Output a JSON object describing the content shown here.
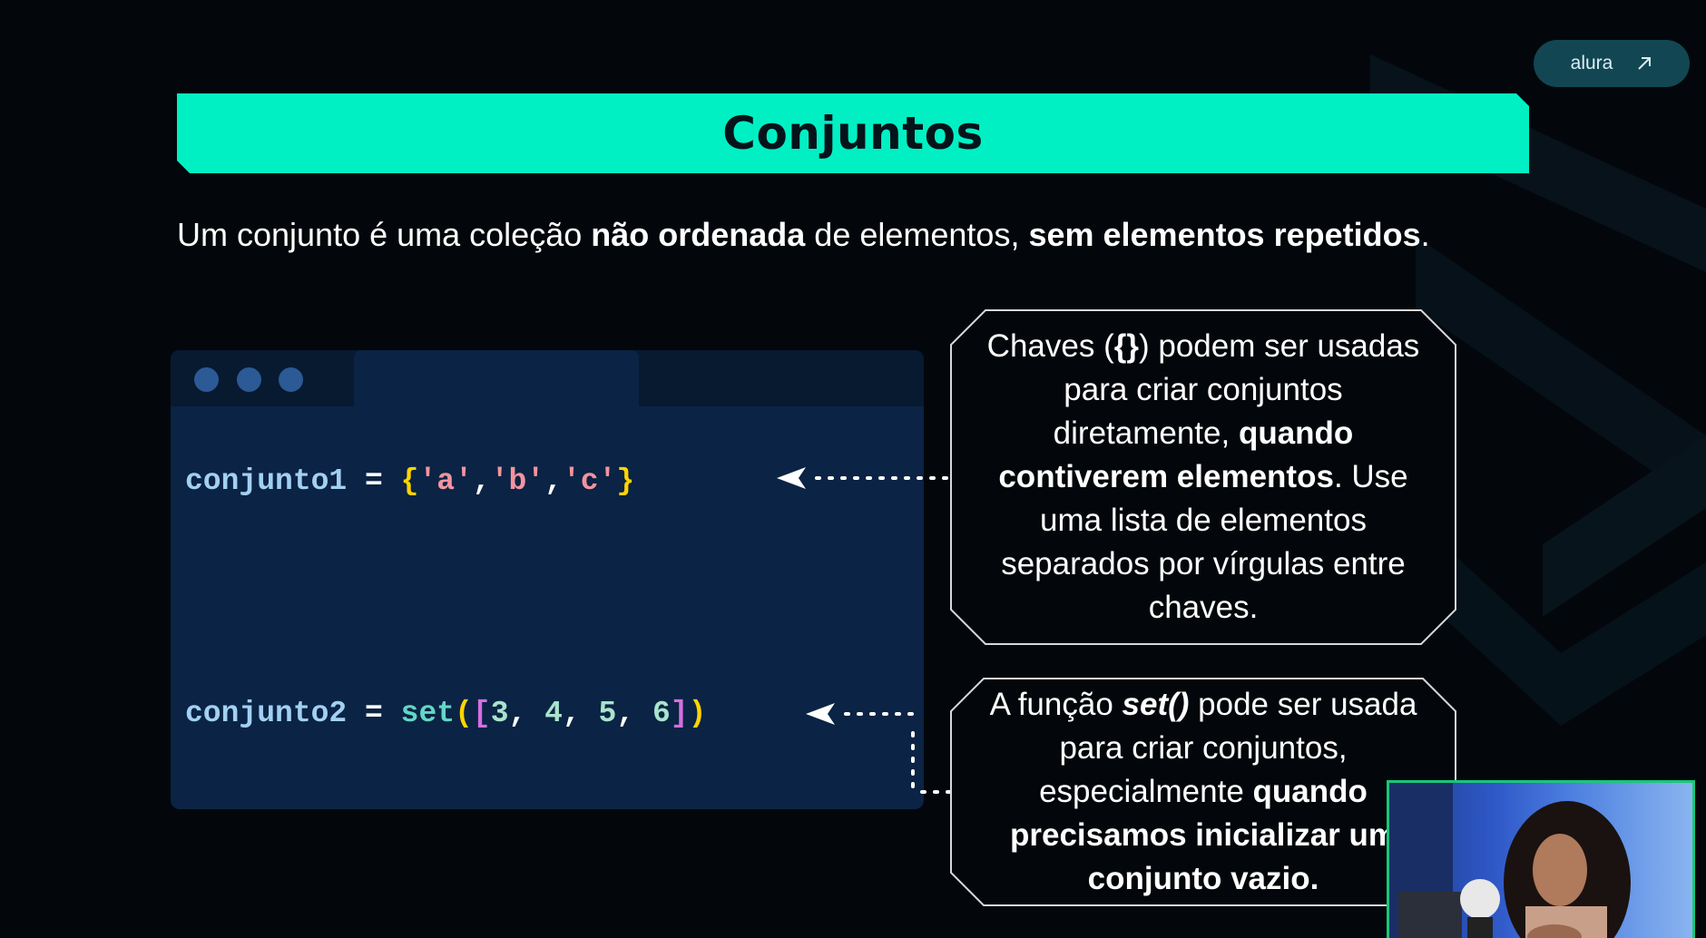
{
  "brand": {
    "name": "alura",
    "icon": "arrow-up-right-icon"
  },
  "slide": {
    "title": "Conjuntos",
    "intro": {
      "t1": "Um conjunto é uma coleção ",
      "b1": "não ordenada",
      "t2": " de elementos, ",
      "b2": "sem elementos repetidos",
      "t3": "."
    }
  },
  "code": {
    "line1": {
      "var": "conjunto1",
      "op": " = ",
      "open": "{",
      "a": "'a'",
      "c1": ",",
      "b": "'b'",
      "c2": ",",
      "c": "'c'",
      "close": "}"
    },
    "line2": {
      "var": "conjunto2",
      "op": " = ",
      "fn": "set",
      "po": "(",
      "bo": "[",
      "n1": "3",
      "s1": ", ",
      "n2": "4",
      "s2": ", ",
      "n3": "5",
      "s3": ", ",
      "n4": "6",
      "bc": "]",
      "pc": ")"
    }
  },
  "callouts": {
    "one": {
      "t1": "Chaves (",
      "b1": "{}",
      "t2": ") podem ser usadas para criar conjuntos diretamente, ",
      "b2": "quando contiverem elementos",
      "t3": ". Use uma lista de elementos separados por vírgulas entre chaves."
    },
    "two": {
      "t1": "A função ",
      "b1": "set()",
      "t2": " pode ser usada para criar conjuntos, especialmente ",
      "b2": "quando precisamos inicializar um conjunto vazio."
    }
  },
  "colors": {
    "background": "#03070b",
    "accent": "#00f0c4",
    "code_bg": "#0b2344",
    "string": "#f2949f",
    "brace": "#ffd400",
    "variable": "#a3d0f2",
    "function": "#63d6c6"
  }
}
